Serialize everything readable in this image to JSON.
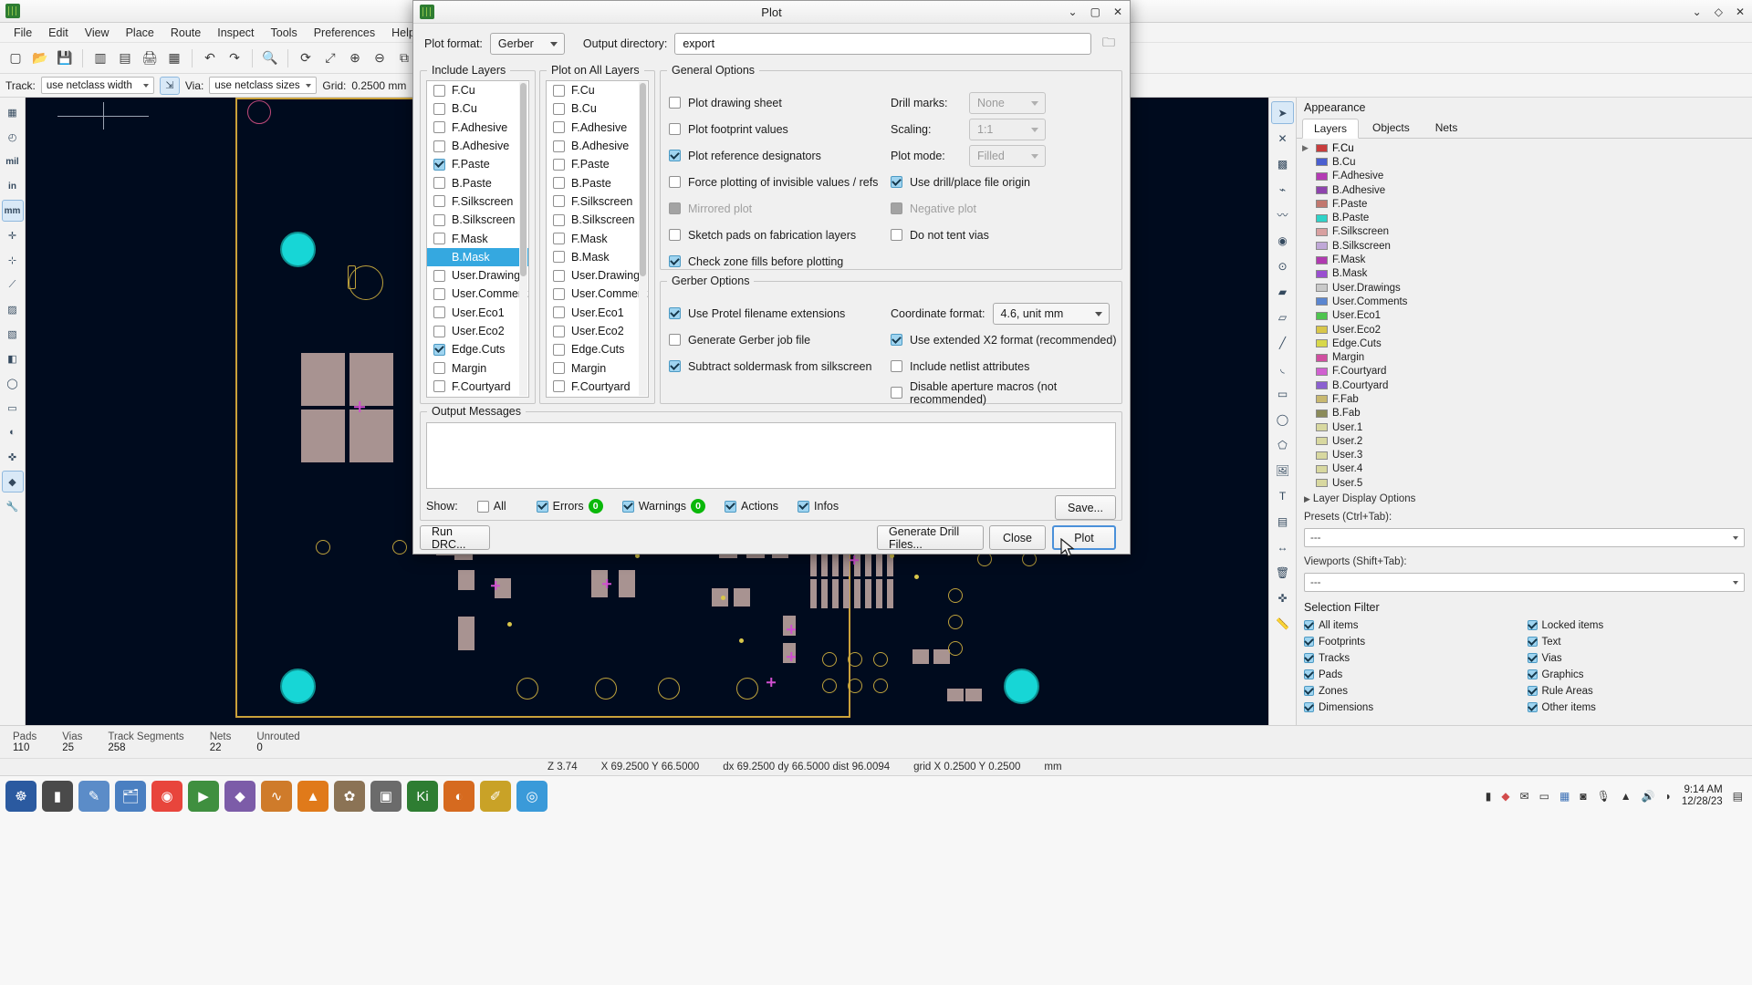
{
  "app": {
    "title": "",
    "icon": "kicad-pcb-icon",
    "window_buttons": [
      "minimize",
      "maximize",
      "close"
    ]
  },
  "menubar": {
    "items": [
      "File",
      "Edit",
      "View",
      "Place",
      "Route",
      "Inspect",
      "Tools",
      "Preferences",
      "Help"
    ]
  },
  "toolbar2": {
    "track_label": "Track:",
    "track_value": "use netclass width",
    "via_label": "Via:",
    "via_value": "use netclass sizes",
    "grid_label": "Grid:",
    "grid_value": "0.2500 mm"
  },
  "left_toolbar": {
    "units": [
      "mil",
      "in",
      "mm"
    ],
    "selected_unit": "mm"
  },
  "appearance": {
    "title": "Appearance",
    "tabs": [
      {
        "label": "Layers",
        "active": true
      },
      {
        "label": "Objects",
        "active": false
      },
      {
        "label": "Nets",
        "active": false
      }
    ],
    "layers": [
      {
        "name": "F.Cu",
        "color": "#c83c3c",
        "selected": true
      },
      {
        "name": "B.Cu",
        "color": "#4a5fd0",
        "selected": false
      },
      {
        "name": "F.Adhesive",
        "color": "#b43bb4",
        "selected": false
      },
      {
        "name": "B.Adhesive",
        "color": "#8e44ad",
        "selected": false
      },
      {
        "name": "F.Paste",
        "color": "#c2786f",
        "selected": false
      },
      {
        "name": "B.Paste",
        "color": "#2fd3c8",
        "selected": false
      },
      {
        "name": "F.Silkscreen",
        "color": "#d8a0a0",
        "selected": false
      },
      {
        "name": "B.Silkscreen",
        "color": "#c0a8d8",
        "selected": false
      },
      {
        "name": "F.Mask",
        "color": "#b03ab0",
        "selected": false
      },
      {
        "name": "B.Mask",
        "color": "#9a4fd0",
        "selected": false
      },
      {
        "name": "User.Drawings",
        "color": "#c9c9c9",
        "selected": false
      },
      {
        "name": "User.Comments",
        "color": "#5b86d0",
        "selected": false
      },
      {
        "name": "User.Eco1",
        "color": "#4fc44f",
        "selected": false
      },
      {
        "name": "User.Eco2",
        "color": "#d8c64a",
        "selected": false
      },
      {
        "name": "Edge.Cuts",
        "color": "#d8d84a",
        "selected": false
      },
      {
        "name": "Margin",
        "color": "#d04fa0",
        "selected": false
      },
      {
        "name": "F.Courtyard",
        "color": "#d060d0",
        "selected": false
      },
      {
        "name": "B.Courtyard",
        "color": "#8b60d0",
        "selected": false
      },
      {
        "name": "F.Fab",
        "color": "#c8b870",
        "selected": false
      },
      {
        "name": "B.Fab",
        "color": "#8b8b5a",
        "selected": false
      },
      {
        "name": "User.1",
        "color": "#d8d8a0",
        "selected": false
      },
      {
        "name": "User.2",
        "color": "#d8d8a0",
        "selected": false
      },
      {
        "name": "User.3",
        "color": "#d8d8a0",
        "selected": false
      },
      {
        "name": "User.4",
        "color": "#d8d8a0",
        "selected": false
      },
      {
        "name": "User.5",
        "color": "#d8d8a0",
        "selected": false
      }
    ],
    "layer_display_options": "Layer Display Options",
    "presets_label": "Presets (Ctrl+Tab):",
    "presets_value": "---",
    "viewports_label": "Viewports (Shift+Tab):",
    "viewports_value": "---",
    "selection_filter_title": "Selection Filter",
    "selection_filter": [
      {
        "label": "All items",
        "checked": true
      },
      {
        "label": "Locked items",
        "checked": true
      },
      {
        "label": "Footprints",
        "checked": true
      },
      {
        "label": "Text",
        "checked": true
      },
      {
        "label": "Tracks",
        "checked": true
      },
      {
        "label": "Vias",
        "checked": true
      },
      {
        "label": "Pads",
        "checked": true
      },
      {
        "label": "Graphics",
        "checked": true
      },
      {
        "label": "Zones",
        "checked": true
      },
      {
        "label": "Rule Areas",
        "checked": true
      },
      {
        "label": "Dimensions",
        "checked": true
      },
      {
        "label": "Other items",
        "checked": true
      }
    ]
  },
  "infobar": {
    "cells": [
      {
        "key": "Pads",
        "value": "110"
      },
      {
        "key": "Vias",
        "value": "25"
      },
      {
        "key": "Track Segments",
        "value": "258"
      },
      {
        "key": "Nets",
        "value": "22"
      },
      {
        "key": "Unrouted",
        "value": "0"
      }
    ]
  },
  "statusbar": {
    "zoom": "Z 3.74",
    "position": "X 69.2500  Y 66.5000",
    "delta": "dx 69.2500  dy 66.5000  dist 96.0094",
    "grid": "grid X 0.2500  Y 0.2500",
    "units": "mm"
  },
  "taskbar": {
    "clock_time": "9:14 AM",
    "clock_date": "12/28/23"
  },
  "dialog": {
    "title": "Plot",
    "plot_format_label": "Plot format:",
    "plot_format_value": "Gerber",
    "output_dir_label": "Output directory:",
    "output_dir_value": "export",
    "output_dir_placeholder": "",
    "browse_icon": "folder-icon",
    "include_layers": {
      "legend": "Include Layers",
      "items": [
        {
          "name": "F.Cu",
          "checked": false,
          "selected": false
        },
        {
          "name": "B.Cu",
          "checked": false,
          "selected": false
        },
        {
          "name": "F.Adhesive",
          "checked": false,
          "selected": false
        },
        {
          "name": "B.Adhesive",
          "checked": false,
          "selected": false
        },
        {
          "name": "F.Paste",
          "checked": true,
          "selected": false
        },
        {
          "name": "B.Paste",
          "checked": false,
          "selected": false
        },
        {
          "name": "F.Silkscreen",
          "checked": false,
          "selected": false
        },
        {
          "name": "B.Silkscreen",
          "checked": false,
          "selected": false
        },
        {
          "name": "F.Mask",
          "checked": false,
          "selected": false
        },
        {
          "name": "B.Mask",
          "checked": false,
          "selected": true
        },
        {
          "name": "User.Drawings",
          "checked": false,
          "selected": false
        },
        {
          "name": "User.Comments",
          "checked": false,
          "selected": false
        },
        {
          "name": "User.Eco1",
          "checked": false,
          "selected": false
        },
        {
          "name": "User.Eco2",
          "checked": false,
          "selected": false
        },
        {
          "name": "Edge.Cuts",
          "checked": true,
          "selected": false
        },
        {
          "name": "Margin",
          "checked": false,
          "selected": false
        },
        {
          "name": "F.Courtyard",
          "checked": false,
          "selected": false
        }
      ]
    },
    "plot_on_all_layers": {
      "legend": "Plot on All Layers",
      "items": [
        {
          "name": "F.Cu",
          "checked": false
        },
        {
          "name": "B.Cu",
          "checked": false
        },
        {
          "name": "F.Adhesive",
          "checked": false
        },
        {
          "name": "B.Adhesive",
          "checked": false
        },
        {
          "name": "F.Paste",
          "checked": false
        },
        {
          "name": "B.Paste",
          "checked": false
        },
        {
          "name": "F.Silkscreen",
          "checked": false
        },
        {
          "name": "B.Silkscreen",
          "checked": false
        },
        {
          "name": "F.Mask",
          "checked": false
        },
        {
          "name": "B.Mask",
          "checked": false
        },
        {
          "name": "User.Drawings",
          "checked": false
        },
        {
          "name": "User.Comments",
          "checked": false
        },
        {
          "name": "User.Eco1",
          "checked": false
        },
        {
          "name": "User.Eco2",
          "checked": false
        },
        {
          "name": "Edge.Cuts",
          "checked": false
        },
        {
          "name": "Margin",
          "checked": false
        },
        {
          "name": "F.Courtyard",
          "checked": false
        }
      ]
    },
    "general_options": {
      "legend": "General Options",
      "left_checks": [
        {
          "label": "Plot drawing sheet",
          "checked": false,
          "disabled": false
        },
        {
          "label": "Plot footprint values",
          "checked": false,
          "disabled": false
        },
        {
          "label": "Plot reference designators",
          "checked": true,
          "disabled": false
        },
        {
          "label": "Force plotting of invisible values / refs",
          "checked": false,
          "disabled": false
        },
        {
          "label": "Mirrored plot",
          "checked": false,
          "disabled": true
        },
        {
          "label": "Sketch pads on fabrication layers",
          "checked": false,
          "disabled": false
        },
        {
          "label": "Check zone fills before plotting",
          "checked": true,
          "disabled": false
        }
      ],
      "drill_marks_label": "Drill marks:",
      "drill_marks_value": "None",
      "scaling_label": "Scaling:",
      "scaling_value": "1:1",
      "plot_mode_label": "Plot mode:",
      "plot_mode_value": "Filled",
      "right_checks": [
        {
          "label": "Use drill/place file origin",
          "checked": true,
          "disabled": false
        },
        {
          "label": "Negative plot",
          "checked": false,
          "disabled": true
        },
        {
          "label": "Do not tent vias",
          "checked": false,
          "disabled": false
        }
      ]
    },
    "gerber_options": {
      "legend": "Gerber Options",
      "left_checks": [
        {
          "label": "Use Protel filename extensions",
          "checked": true
        },
        {
          "label": "Generate Gerber job file",
          "checked": false
        },
        {
          "label": "Subtract soldermask from silkscreen",
          "checked": true
        }
      ],
      "coordinate_format_label": "Coordinate format:",
      "coordinate_format_value": "4.6, unit mm",
      "right_checks": [
        {
          "label": "Use extended X2 format (recommended)",
          "checked": true
        },
        {
          "label": "Include netlist attributes",
          "checked": false
        },
        {
          "label": "Disable aperture macros (not recommended)",
          "checked": false
        }
      ]
    },
    "output_messages": {
      "legend": "Output Messages",
      "body": "",
      "show_label": "Show:",
      "filters": [
        {
          "label": "All",
          "checked": false,
          "count": null
        },
        {
          "label": "Errors",
          "checked": true,
          "count": "0"
        },
        {
          "label": "Warnings",
          "checked": true,
          "count": "0"
        },
        {
          "label": "Actions",
          "checked": true,
          "count": null
        },
        {
          "label": "Infos",
          "checked": true,
          "count": null
        }
      ],
      "save_label": "Save..."
    },
    "buttons": {
      "run_drc": "Run DRC...",
      "generate_drill": "Generate Drill Files...",
      "close": "Close",
      "plot": "Plot"
    },
    "accent_color": "#35a8e0",
    "badge_color": "#0ab80a"
  }
}
